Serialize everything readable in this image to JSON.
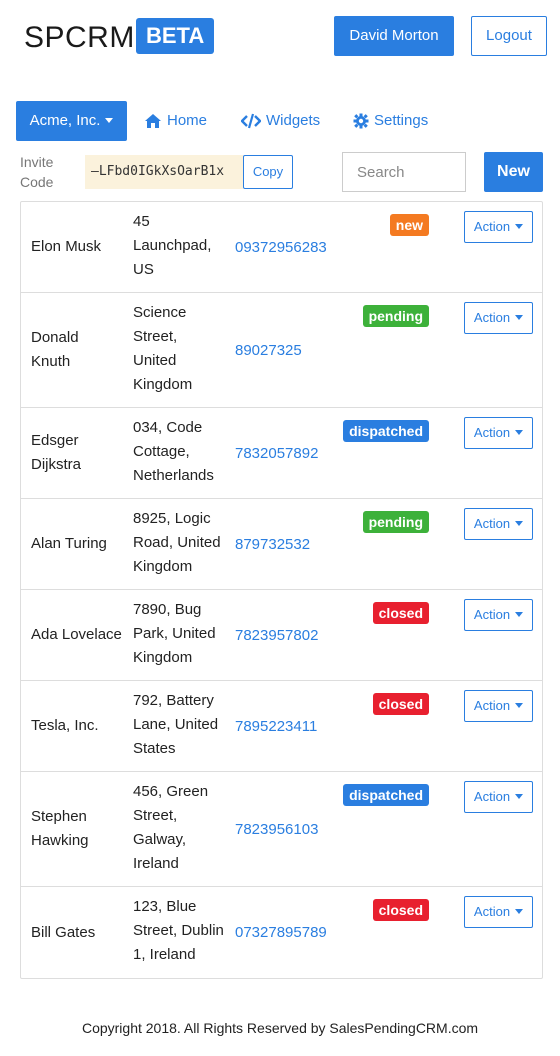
{
  "header": {
    "brand": "SPCRM",
    "beta": "BETA",
    "user_name": "David Morton",
    "logout_label": "Logout"
  },
  "nav": {
    "org_label": "Acme, Inc.",
    "home_label": "Home",
    "widgets_label": "Widgets",
    "settings_label": "Settings"
  },
  "invite": {
    "label_line1": "Invite",
    "label_line2": "Code",
    "code": "—LFbd0IGkXsOarB1x",
    "copy_label": "Copy"
  },
  "search": {
    "placeholder": "Search",
    "value": ""
  },
  "new_label": "New",
  "rows": [
    {
      "name": [
        "Elon Musk"
      ],
      "address": [
        "45",
        "Launchpad,",
        "US"
      ],
      "phone": "09372956283",
      "status": "new"
    },
    {
      "name": [
        "Donald",
        "Knuth"
      ],
      "address": [
        "Science",
        "Street,",
        "United",
        "Kingdom"
      ],
      "phone": "89027325",
      "status": "pending"
    },
    {
      "name": [
        "Edsger",
        "Dijkstra"
      ],
      "address": [
        "034, Code",
        "Cottage,",
        "Netherlands"
      ],
      "phone": "7832057892",
      "status": "dispatched"
    },
    {
      "name": [
        "Alan Turing"
      ],
      "address": [
        "8925, Logic",
        "Road, United",
        "Kingdom"
      ],
      "phone": "879732532",
      "status": "pending"
    },
    {
      "name": [
        "Ada Lovelace"
      ],
      "address": [
        "7890, Bug",
        "Park, United",
        "Kingdom"
      ],
      "phone": "7823957802",
      "status": "closed"
    },
    {
      "name": [
        "Tesla, Inc."
      ],
      "address": [
        "792, Battery",
        "Lane, United",
        "States"
      ],
      "phone": "7895223411",
      "status": "closed"
    },
    {
      "name": [
        "Stephen",
        "Hawking"
      ],
      "address": [
        "456, Green",
        "Street,",
        "Galway,",
        "Ireland"
      ],
      "phone": "7823956103",
      "status": "dispatched"
    },
    {
      "name": [
        "Bill Gates"
      ],
      "address": [
        "123, Blue",
        "Street, Dublin",
        "1, Ireland"
      ],
      "phone": "07327895789",
      "status": "closed"
    }
  ],
  "action_label": "Action",
  "footer": "Copyright 2018. All Rights Reserved by SalesPendingCRM.com",
  "colors": {
    "primary": "#2a7ee0",
    "status_new": "#f47a21",
    "status_pending": "#3db13a",
    "status_dispatched": "#2a7ee0",
    "status_closed": "#e8202f",
    "invite_bg": "#fbf2dc"
  }
}
